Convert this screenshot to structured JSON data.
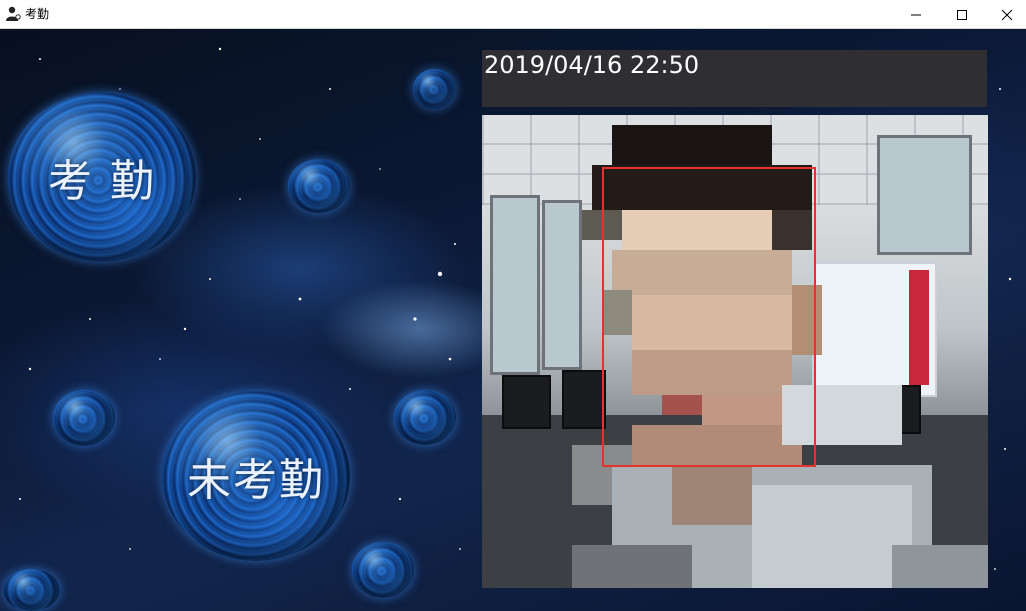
{
  "window": {
    "title": "考勤",
    "icon": "person-icon",
    "controls": {
      "minimize": "minimize-icon",
      "maximize": "maximize-icon",
      "close": "close-icon"
    }
  },
  "orbs": {
    "checkin": {
      "label": "考 勤"
    },
    "not_checked": {
      "label": "未考勤"
    }
  },
  "panel": {
    "datetime": "2019/04/16 22:50"
  },
  "camera": {
    "face_box_color": "#e2332d"
  },
  "colors": {
    "datetime_bar": "#2f2e33",
    "orb_glow": "#3c8cf0",
    "titlebar": "#ffffff"
  }
}
